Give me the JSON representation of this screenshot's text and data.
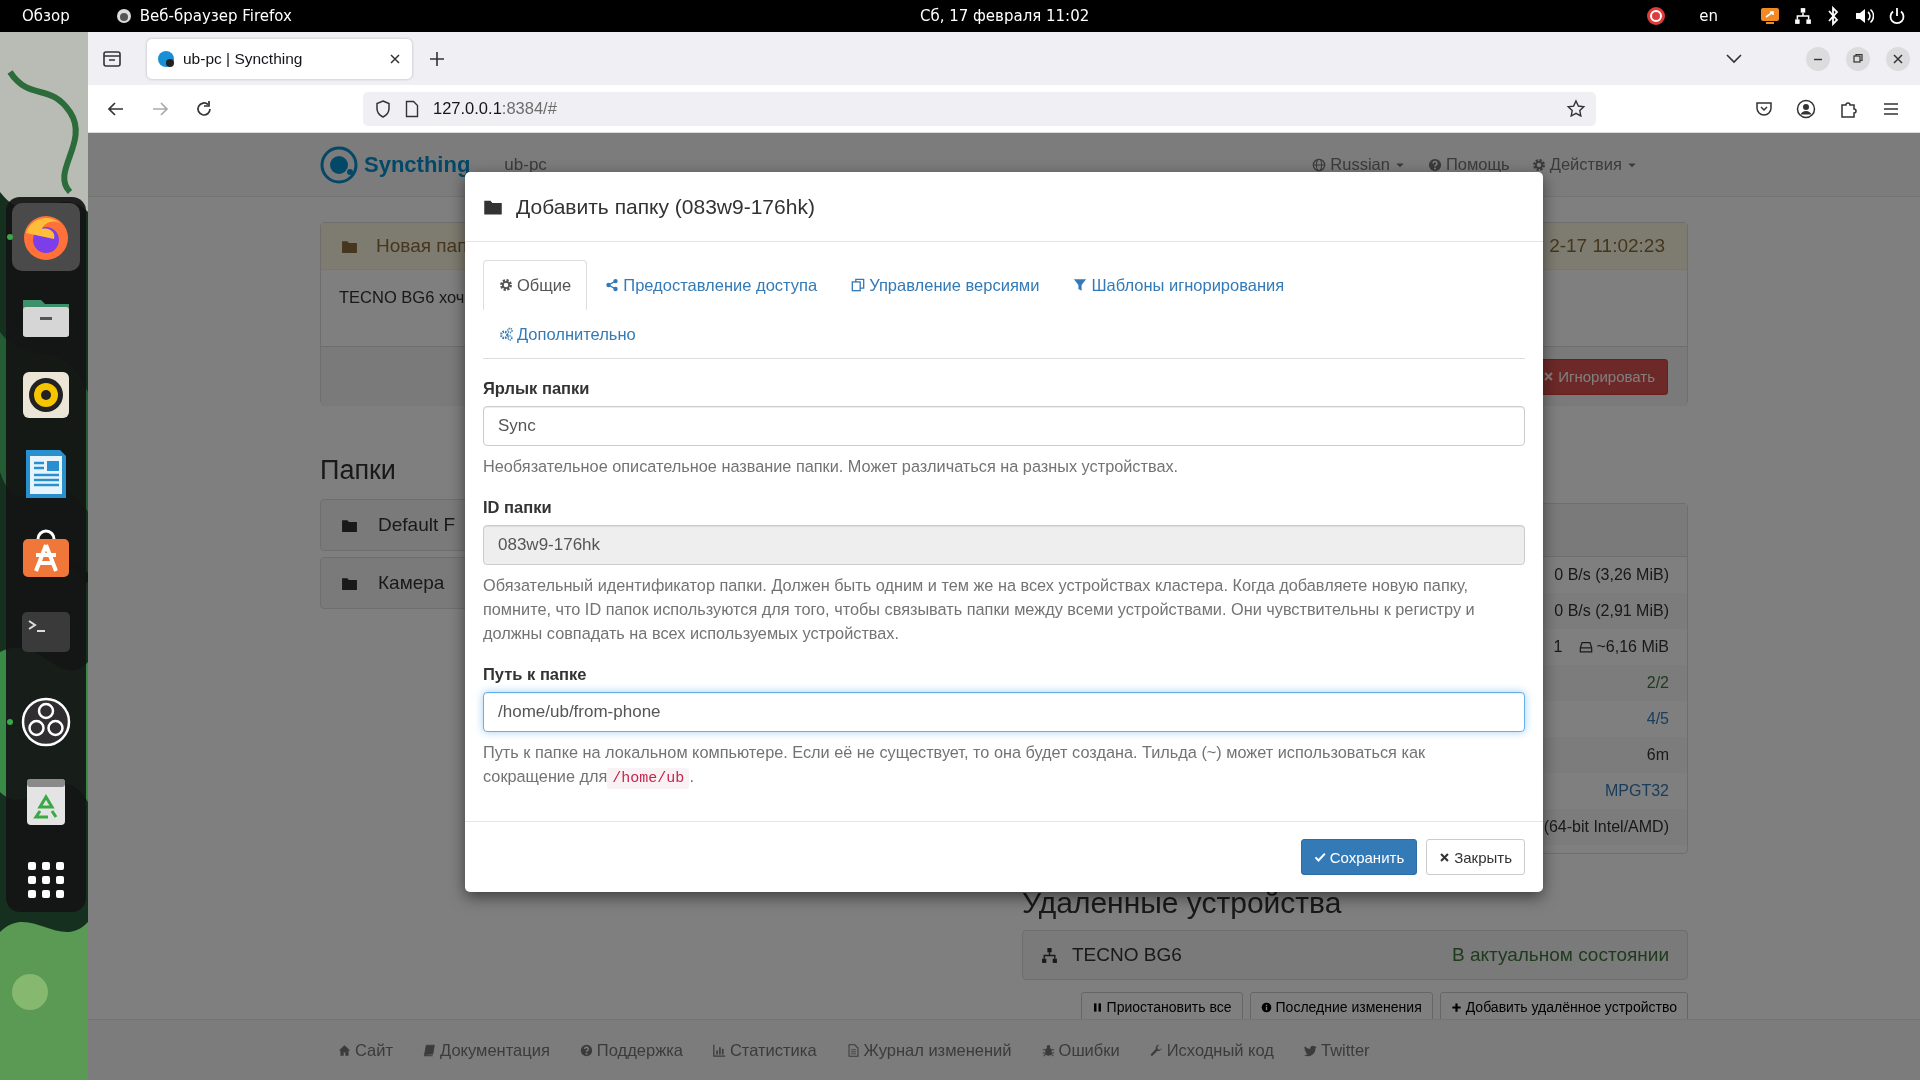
{
  "top_bar": {
    "activities": "Обзор",
    "app": "Веб-браузер Firefox",
    "clock": "Сб, 17 февраля  11:02",
    "keyboard": "en"
  },
  "dock": {
    "items": [
      {
        "kind": "firefox",
        "running": true,
        "active": true
      },
      {
        "kind": "files",
        "running": false,
        "active": false
      },
      {
        "kind": "rhythmbox",
        "running": false,
        "active": false
      },
      {
        "kind": "writer",
        "running": false,
        "active": false
      },
      {
        "kind": "appcenter",
        "running": false,
        "active": false
      },
      {
        "kind": "terminal",
        "running": false,
        "active": false
      },
      {
        "kind": "obs",
        "running": true,
        "active": false
      },
      {
        "kind": "trash",
        "running": false,
        "active": false
      },
      {
        "kind": "grid",
        "running": false,
        "active": false
      }
    ]
  },
  "browser": {
    "tabs": [
      {
        "title": "ub-pc | Syncthing",
        "selected": true
      }
    ],
    "address": {
      "host": "127.0.0.1",
      "path": ":8384/#"
    }
  },
  "page": {
    "brand": "Syncthing",
    "device_name": "ub-pc",
    "menus": [
      {
        "label": "Russian",
        "kind": "globe",
        "caret": true
      },
      {
        "label": "Помощь",
        "kind": "question",
        "caret": false
      },
      {
        "label": "Действия",
        "kind": "gear",
        "caret": true
      }
    ],
    "notice": {
      "title": "Новая пап",
      "time": "2-17 11:02:23",
      "text": "TECNO BG6 хоч",
      "ignore_button": "Игнорировать"
    },
    "folders_heading": "Папки",
    "folders": [
      {
        "name": "Default F"
      },
      {
        "name": "Камера"
      }
    ],
    "device_rows": [
      {
        "kind": "text",
        "values": [
          "0 B/s (3,26 MiB)"
        ]
      },
      {
        "kind": "text",
        "values": [
          "0 B/s (2,91 MiB)"
        ]
      },
      {
        "kind": "counts",
        "values": [
          "1",
          "~6,16 MiB"
        ]
      },
      {
        "kind": "success",
        "values": [
          "2/2"
        ]
      },
      {
        "kind": "link",
        "values": [
          "4/5"
        ]
      },
      {
        "kind": "text",
        "values": [
          "6m"
        ]
      },
      {
        "kind": "link",
        "values": [
          "MPGT32"
        ]
      },
      {
        "kind": "text",
        "values": [
          "(64-bit Intel/AMD)"
        ]
      }
    ],
    "remote_heading": "Удаленные устройства",
    "remote_devices": [
      {
        "name": "TECNO BG6",
        "status": "В актуальном состоянии"
      }
    ],
    "remote_buttons": [
      {
        "label": "Приостановить все",
        "kind": "pause"
      },
      {
        "label": "Последние изменения",
        "kind": "info"
      },
      {
        "label": "Добавить удалённое устройство",
        "kind": "plus"
      }
    ],
    "footer": [
      {
        "label": "Сайт",
        "kind": "home"
      },
      {
        "label": "Документация",
        "kind": "book"
      },
      {
        "label": "Поддержка",
        "kind": "question"
      },
      {
        "label": "Статистика",
        "kind": "chart"
      },
      {
        "label": "Журнал изменений",
        "kind": "file"
      },
      {
        "label": "Ошибки",
        "kind": "bug"
      },
      {
        "label": "Исходный код",
        "kind": "wrench"
      },
      {
        "label": "Twitter",
        "kind": "bird"
      }
    ]
  },
  "modal": {
    "title": "Добавить папку (083w9-176hk)",
    "tabs": [
      {
        "label": "Общие",
        "kind": "gear",
        "selected": true
      },
      {
        "label": "Предоставление доступа",
        "kind": "share",
        "selected": false
      },
      {
        "label": "Управление версиями",
        "kind": "copy",
        "selected": false
      },
      {
        "label": "Шаблоны игнорирования",
        "kind": "filter",
        "selected": false
      },
      {
        "label": "Дополнительно",
        "kind": "cogs",
        "selected": false
      }
    ],
    "fields": [
      {
        "label": "Ярлык папки",
        "value": "Sync",
        "disabled": false,
        "focused": false,
        "help": "Необязательное описательное название папки. Может различаться на разных устройствах."
      },
      {
        "label": "ID папки",
        "value": "083w9-176hk",
        "disabled": true,
        "focused": false,
        "help": "Обязательный идентификатор папки. Должен быть одним и тем же на всех устройствах кластера. Когда добавляете новую папку, помните, что ID папок используются для того, чтобы связывать папки между всеми устройствами. Они чувствительны к регистру и должны совпадать на всех используемых устройствах."
      },
      {
        "label": "Путь к папке",
        "value": "/home/ub/from-phone",
        "disabled": false,
        "focused": true,
        "help": "Путь к папке на локальном компьютере. Если её не существует, то она будет создана. Тильда (~) может использоваться как сокращение для",
        "help_code": "/home/ub",
        "help_end": "."
      }
    ],
    "save_button": "Сохранить",
    "close_button": "Закрыть"
  }
}
